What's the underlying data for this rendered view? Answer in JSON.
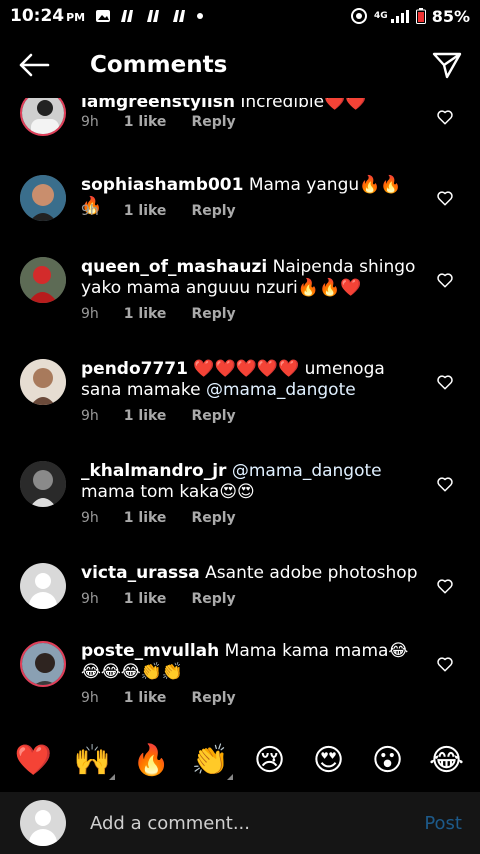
{
  "status": {
    "time": "10:24",
    "ampm": "PM",
    "battery": "85%",
    "net": "4G"
  },
  "header": {
    "title": "Comments"
  },
  "comments": [
    {
      "username": "iamgreenstylish",
      "text": "Incredible❤️❤️",
      "time": "9h",
      "likes": "1 like",
      "reply": "Reply"
    },
    {
      "username": "sophiashamb001",
      "text": "Mama yangu🔥🔥🔥",
      "time": "9h",
      "likes": "1 like",
      "reply": "Reply"
    },
    {
      "username": "queen_of_mashauzi",
      "text": "Naipenda shingo yako mama anguuu nzuri🔥🔥❤️",
      "time": "9h",
      "likes": "1 like",
      "reply": "Reply"
    },
    {
      "username": "pendo7771",
      "text": "❤️❤️❤️❤️❤️ umenoga sana mamake ",
      "mention": "@mama_dangote",
      "time": "9h",
      "likes": "1 like",
      "reply": "Reply"
    },
    {
      "username": "_khalmandro_jr",
      "mention": "@mama_dangote",
      "text": " mama tom kaka😍😍",
      "time": "9h",
      "likes": "1 like",
      "reply": "Reply"
    },
    {
      "username": "victa_urassa",
      "text": "Asante adobe photoshop",
      "time": "9h",
      "likes": "1 like",
      "reply": "Reply"
    },
    {
      "username": "poste_mvullah",
      "text": "Mama kama mama😂😂😂😂👏👏",
      "time": "9h",
      "likes": "1 like",
      "reply": "Reply"
    }
  ],
  "reactions": [
    "❤️",
    "🙌",
    "🔥",
    "👏",
    "😢",
    "😍",
    "😮",
    "😂"
  ],
  "composer": {
    "placeholder": "Add a comment...",
    "post_label": "Post"
  },
  "colors": {
    "background": "#000000",
    "accent_post": "#1d5a8a",
    "muted": "#9a9a9a",
    "ring": "#e0405a"
  }
}
